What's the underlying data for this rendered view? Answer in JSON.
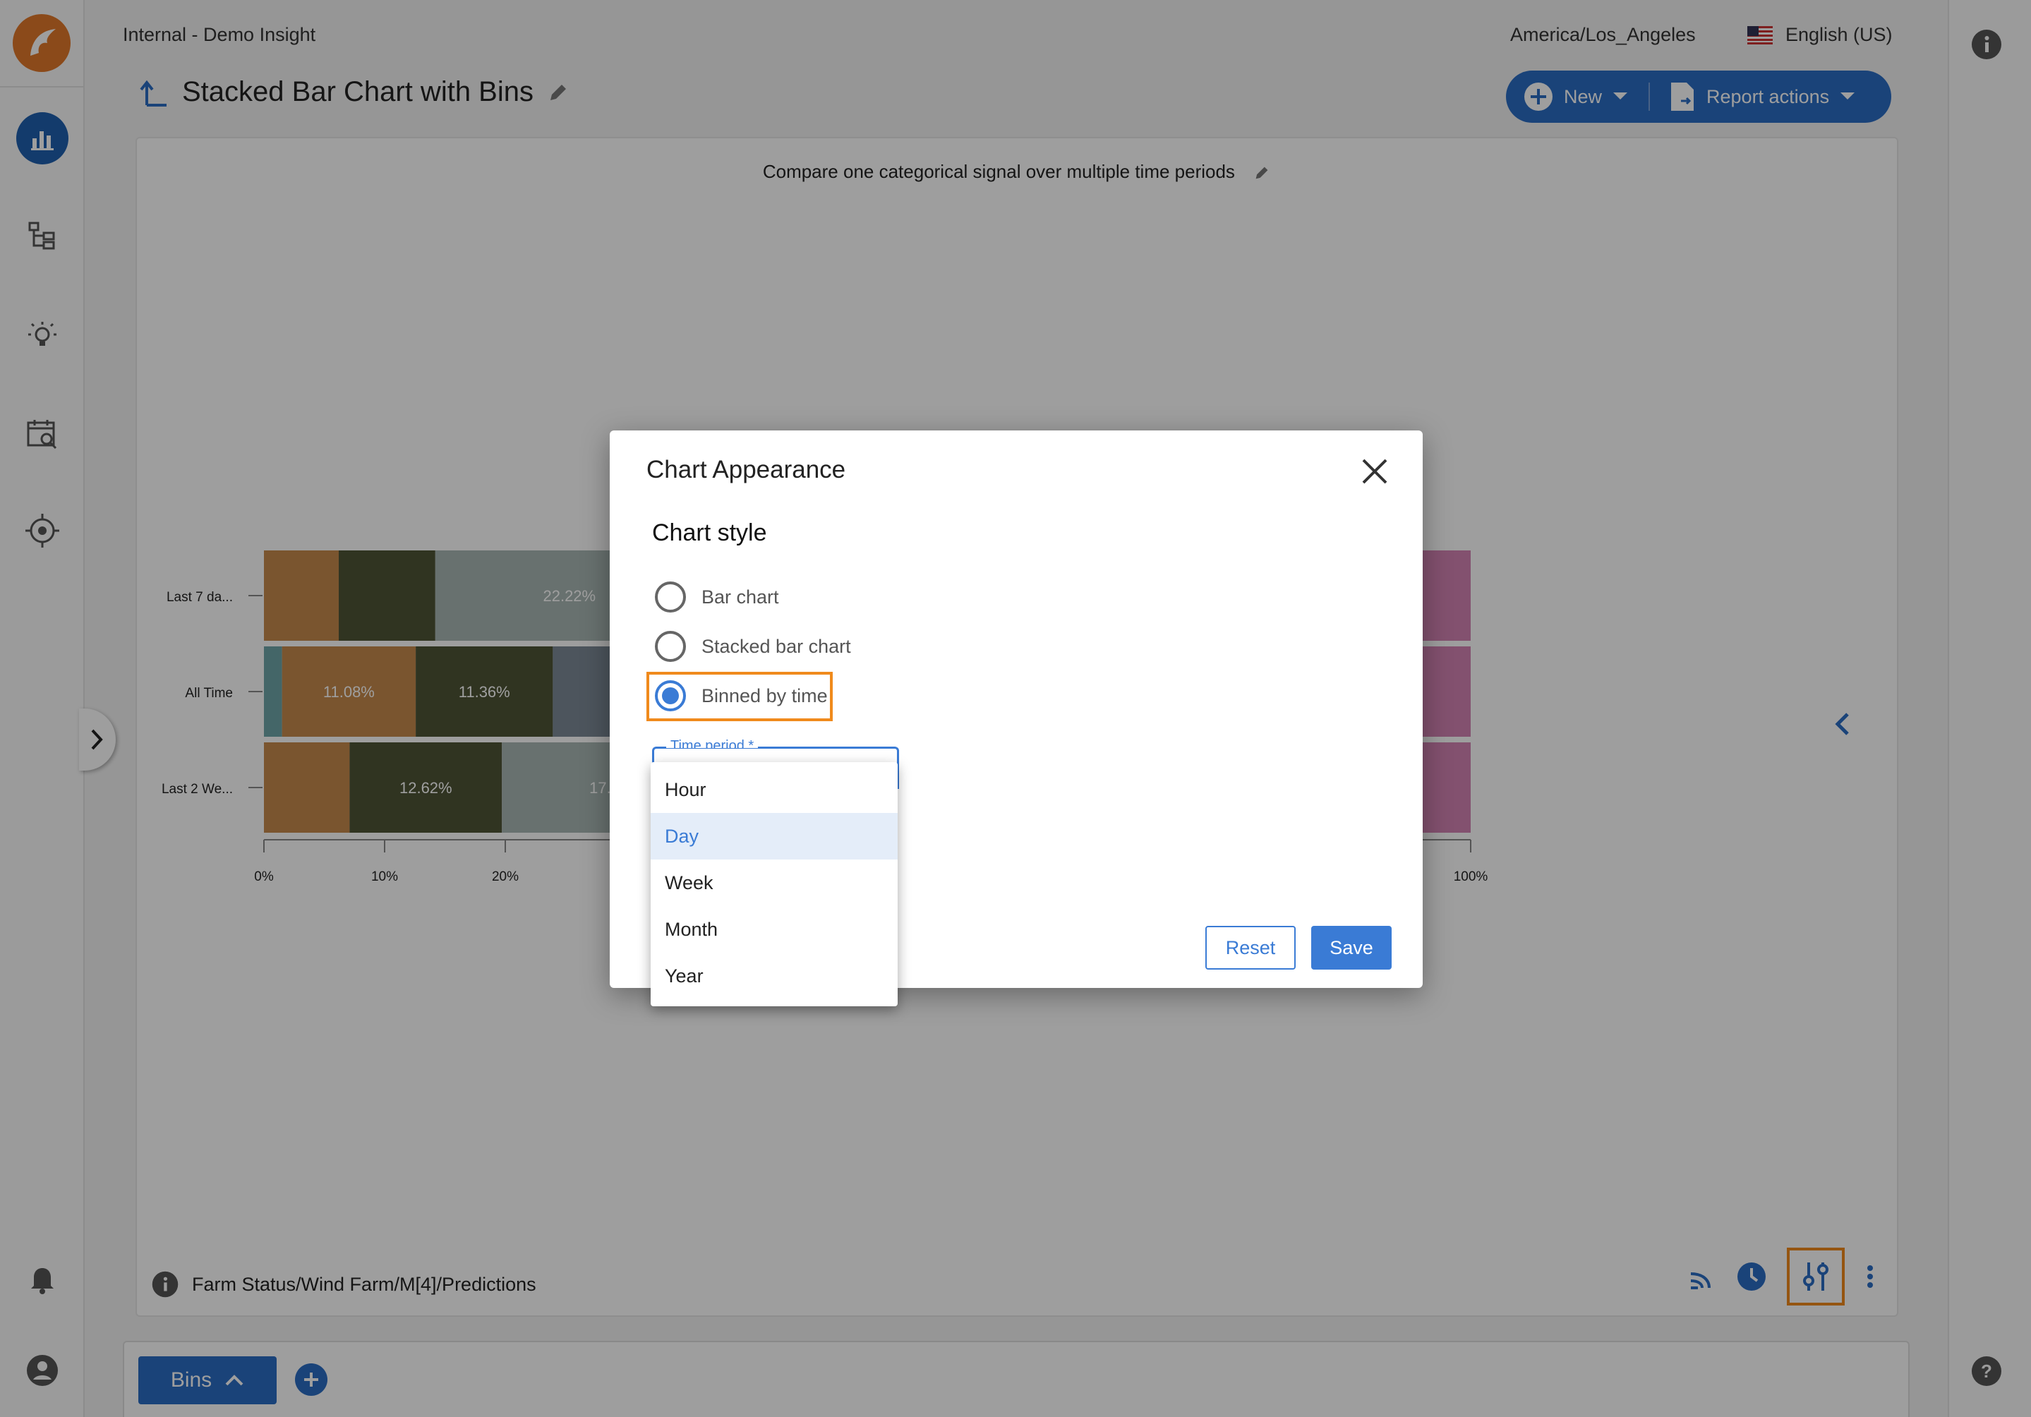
{
  "topbar": {
    "workspace": "Internal - Demo Insight",
    "timezone": "America/Los_Angeles",
    "language": "English (US)"
  },
  "report": {
    "title": "Stacked Bar Chart with Bins",
    "subtitle": "Compare one categorical signal over multiple time periods",
    "source_path": "Farm Status/Wind Farm/M[4]/Predictions"
  },
  "actions": {
    "new_label": "New",
    "report_actions_label": "Report actions"
  },
  "nav_icons": [
    "dashboard-icon",
    "hierarchy-icon",
    "lightbulb-icon",
    "calendar-search-icon",
    "target-icon",
    "bell-icon",
    "account-icon"
  ],
  "bottom": {
    "bins_label": "Bins"
  },
  "chart_data": {
    "type": "bar",
    "orientation": "horizontal",
    "stacked": true,
    "categories": [
      "Last 7 da...",
      "All Time",
      "Last 2 We..."
    ],
    "x_ticks": [
      "0%",
      "10%",
      "20%",
      "100%"
    ],
    "xlim": [
      0,
      100
    ],
    "segments": [
      {
        "row": 0,
        "start": 0,
        "width": 6.2,
        "color": "#c58a4c",
        "label": ""
      },
      {
        "row": 0,
        "start": 6.2,
        "width": 8.0,
        "color": "#4e5536",
        "label": ""
      },
      {
        "row": 0,
        "start": 14.2,
        "width": 22.22,
        "color": "#a9b7b4",
        "label": "22.22%"
      },
      {
        "row": 1,
        "start": 0,
        "width": 1.5,
        "color": "#6fa5a8",
        "label": ""
      },
      {
        "row": 1,
        "start": 1.5,
        "width": 11.08,
        "color": "#c58a4c",
        "label": "11.08%"
      },
      {
        "row": 1,
        "start": 12.58,
        "width": 11.36,
        "color": "#4e5536",
        "label": "11.36%"
      },
      {
        "row": 1,
        "start": 23.94,
        "width": 8.0,
        "color": "#7d8a96",
        "label": ""
      },
      {
        "row": 2,
        "start": 0,
        "width": 7.1,
        "color": "#c58a4c",
        "label": ""
      },
      {
        "row": 2,
        "start": 7.1,
        "width": 12.62,
        "color": "#4e5536",
        "label": "12.62%"
      },
      {
        "row": 2,
        "start": 19.72,
        "width": 17.0,
        "color": "#a9b7b4",
        "label": "17.0"
      },
      {
        "row": 0,
        "start": 95.6,
        "width": 4.4,
        "color": "#d383b4",
        "label": ""
      },
      {
        "row": 1,
        "start": 95.6,
        "width": 4.4,
        "color": "#d383b4",
        "label": ""
      },
      {
        "row": 2,
        "start": 95.6,
        "width": 4.4,
        "color": "#d383b4",
        "label": ""
      }
    ]
  },
  "modal": {
    "title": "Chart Appearance",
    "section": "Chart style",
    "options": [
      "Bar chart",
      "Stacked bar chart",
      "Binned by time"
    ],
    "selected_option": "Binned by time",
    "select_label": "Time period *",
    "reset_label": "Reset",
    "save_label": "Save"
  },
  "dropdown": {
    "items": [
      "Hour",
      "Day",
      "Week",
      "Month",
      "Year"
    ],
    "selected": "Day"
  },
  "colors": {
    "accent": "#3a7bd5",
    "highlight": "#f08a1c",
    "brand": "#e0782a"
  }
}
